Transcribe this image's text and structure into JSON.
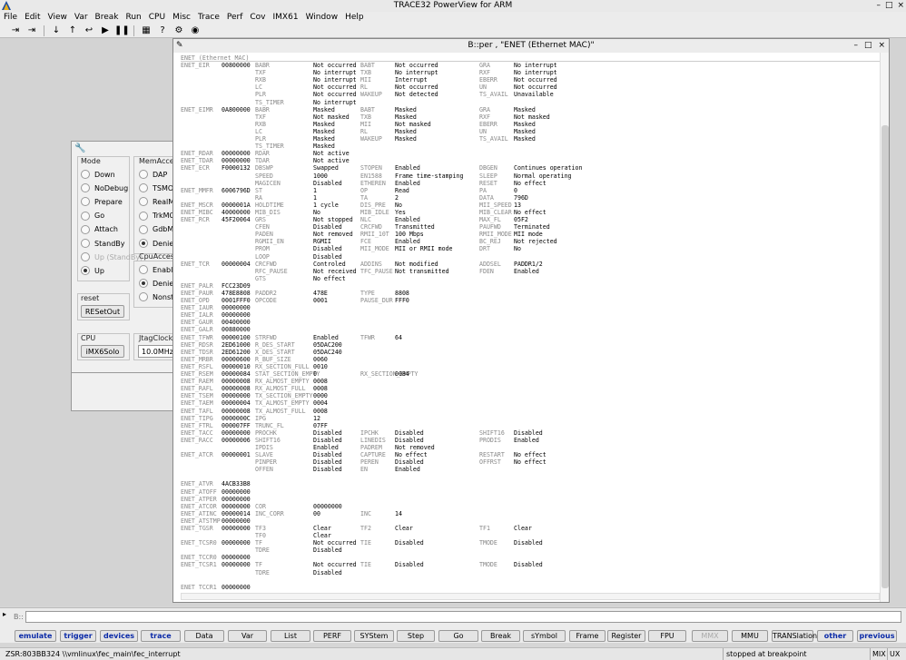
{
  "window": {
    "title": "TRACE32 PowerView for ARM"
  },
  "menu": [
    "File",
    "Edit",
    "View",
    "Var",
    "Break",
    "Run",
    "CPU",
    "Misc",
    "Trace",
    "Perf",
    "Cov",
    "IMX61",
    "Window",
    "Help"
  ],
  "toolbar": {
    "icons": [
      "step-into-icon",
      "step-over-icon",
      "step-down-icon",
      "step-up-icon",
      "return-icon",
      "go-icon",
      "break-icon",
      "config-icon",
      "help-icon",
      "about-icon",
      "globe-icon"
    ]
  },
  "system": {
    "mode_label": "Mode",
    "modes": [
      {
        "label": "Down"
      },
      {
        "label": "NoDebug"
      },
      {
        "label": "Prepare"
      },
      {
        "label": "Go"
      },
      {
        "label": "Attach"
      },
      {
        "label": "StandBy"
      },
      {
        "label": "Up (StandBy)",
        "disabled": true
      },
      {
        "label": "Up",
        "selected": true
      }
    ],
    "memaccess_label": "MemAcces",
    "memaccess": [
      {
        "label": "DAP"
      },
      {
        "label": "TSMON"
      },
      {
        "label": "RealMo"
      },
      {
        "label": "TrkMO"
      },
      {
        "label": "GdbMO"
      },
      {
        "label": "Deniec",
        "selected": true
      }
    ],
    "cpuaccess_label": "CpuAccess",
    "cpuaccess": [
      {
        "label": "Enable"
      },
      {
        "label": "Deniec",
        "selected": true
      },
      {
        "label": "Nonsto"
      }
    ],
    "reset_label": "reset",
    "reset_button": "RESetOut",
    "cpu_label": "CPU",
    "cpu_button": "iMX6Solo",
    "jtag_label": "JtagClock",
    "jtag_value": "10.0MHz"
  },
  "per": {
    "title": "B::per , \"ENET (Ethernet MAC)\"",
    "header": "ENET (Ethernet MAC)",
    "rows": [
      [
        "ENET_EIR",
        "00800000",
        "BABR",
        "Not occurred",
        "BABT",
        "Not occurred",
        "GRA",
        "No interrupt"
      ],
      [
        "",
        "",
        "TXF",
        "No interrupt",
        "TXB",
        "No interrupt",
        "RXF",
        "No interrupt"
      ],
      [
        "",
        "",
        "RXB",
        "No interrupt",
        "MII",
        "Interrupt",
        "EBERR",
        "Not occurred"
      ],
      [
        "",
        "",
        "LC",
        "Not occurred",
        "RL",
        "Not occurred",
        "UN",
        "Not occurred"
      ],
      [
        "",
        "",
        "PLR",
        "Not occurred",
        "WAKEUP",
        "Not detected",
        "TS_AVAIL",
        "Unavailable"
      ],
      [
        "",
        "",
        "TS_TIMER",
        "No interrupt",
        "",
        "",
        "",
        ""
      ],
      [
        "ENET_EIMR",
        "0A800000",
        "BABR",
        "Masked",
        "BABT",
        "Masked",
        "GRA",
        "Masked"
      ],
      [
        "",
        "",
        "TXF",
        "Not masked",
        "TXB",
        "Masked",
        "RXF",
        "Not masked"
      ],
      [
        "",
        "",
        "RXB",
        "Masked",
        "MII",
        "Not masked",
        "EBERR",
        "Masked"
      ],
      [
        "",
        "",
        "LC",
        "Masked",
        "RL",
        "Masked",
        "UN",
        "Masked"
      ],
      [
        "",
        "",
        "PLR",
        "Masked",
        "WAKEUP",
        "Masked",
        "TS_AVAIL",
        "Masked"
      ],
      [
        "",
        "",
        "TS_TIMER",
        "Masked",
        "",
        "",
        "",
        ""
      ],
      [
        "ENET_RDAR",
        "00000000",
        "RDAR",
        "Not active",
        "",
        "",
        "",
        ""
      ],
      [
        "ENET_TDAR",
        "00000000",
        "TDAR",
        "Not active",
        "",
        "",
        "",
        ""
      ],
      [
        "ENET_ECR",
        "F0000132",
        "DBSWP",
        "Swapped",
        "STOPEN",
        "Enabled",
        "DBGEN",
        "Continues operation"
      ],
      [
        "",
        "",
        "SPEED",
        "1000",
        "EN1588",
        "Frame time-stamping",
        "SLEEP",
        "Normal operating"
      ],
      [
        "",
        "",
        "MAGICEN",
        "Disabled",
        "ETHEREN",
        "Enabled",
        "RESET",
        "No effect"
      ],
      [
        "ENET_MMFR",
        "6006796D",
        "ST",
        "1",
        "OP",
        "Read",
        "PA",
        "0"
      ],
      [
        "",
        "",
        "RA",
        "1",
        "TA",
        "2",
        "DATA",
        "796D"
      ],
      [
        "ENET_MSCR",
        "0000001A",
        "HOLDTIME",
        "1 cycle",
        "DIS_PRE",
        "No",
        "MII_SPEED",
        "13"
      ],
      [
        "ENET_MIBC",
        "40000000",
        "MIB_DIS",
        "No",
        "MIB_IDLE",
        "Yes",
        "MIB_CLEAR",
        "No effect"
      ],
      [
        "ENET_RCR",
        "45F20064",
        "GRS",
        "Not stopped",
        "NLC",
        "Enabled",
        "MAX_FL",
        "05F2"
      ],
      [
        "",
        "",
        "CFEN",
        "Disabled",
        "CRCFWD",
        "Transmitted",
        "PAUFWD",
        "Terminated"
      ],
      [
        "",
        "",
        "PADEN",
        "Not removed",
        "RMII_10T",
        "100 Mbps",
        "RMII_MODE",
        "MII mode"
      ],
      [
        "",
        "",
        "RGMII_EN",
        "RGMII",
        "FCE",
        "Enabled",
        "BC_REJ",
        "Not rejected"
      ],
      [
        "",
        "",
        "PROM",
        "Disabled",
        "MII_MODE",
        "MII or RMII mode",
        "DRT",
        "No"
      ],
      [
        "",
        "",
        "LOOP",
        "Disabled",
        "",
        "",
        "",
        ""
      ],
      [
        "ENET_TCR",
        "00000004",
        "CRCFWD",
        "Controled",
        "ADDINS",
        "Not modified",
        "ADDSEL",
        "PADDR1/2"
      ],
      [
        "",
        "",
        "RFC_PAUSE",
        "Not received",
        "TFC_PAUSE",
        "Not transmitted",
        "FDEN",
        "Enabled"
      ],
      [
        "",
        "",
        "GTS",
        "No effect",
        "",
        "",
        "",
        ""
      ],
      [
        "ENET_PALR",
        "FCC23D09",
        "",
        "",
        "",
        "",
        "",
        ""
      ],
      [
        "ENET_PAUR",
        "478E8808",
        "PADDR2",
        "478E",
        "TYPE",
        "8808",
        "",
        ""
      ],
      [
        "ENET_OPD",
        "0001FFF0",
        "OPCODE",
        "0001",
        "PAUSE_DUR",
        "FFF0",
        "",
        ""
      ],
      [
        "ENET_IAUR",
        "00000000",
        "",
        "",
        "",
        "",
        "",
        ""
      ],
      [
        "ENET_IALR",
        "00000000",
        "",
        "",
        "",
        "",
        "",
        ""
      ],
      [
        "ENET_GAUR",
        "00400000",
        "",
        "",
        "",
        "",
        "",
        ""
      ],
      [
        "ENET_GALR",
        "00880000",
        "",
        "",
        "",
        "",
        "",
        ""
      ],
      [
        "ENET_TFWR",
        "00000100",
        "STRFWD",
        "Enabled",
        "TFWR",
        "64",
        "",
        ""
      ],
      [
        "ENET_RDSR",
        "2ED61000",
        "R_DES_START",
        "05DAC200",
        "",
        "",
        "",
        ""
      ],
      [
        "ENET_TDSR",
        "2ED61200",
        "X_DES_START",
        "05DAC240",
        "",
        "",
        "",
        ""
      ],
      [
        "ENET_MRBR",
        "00000600",
        "R_BUF_SIZE",
        "0060",
        "",
        "",
        "",
        ""
      ],
      [
        "ENET_RSFL",
        "00000010",
        "RX_SECTION_FULL",
        "0010",
        "",
        "",
        "",
        ""
      ],
      [
        "ENET_RSEM",
        "00000084",
        "STAT_SECTION_EMPTY",
        "0",
        "RX_SECTION_EMPTY",
        "0084",
        "",
        ""
      ],
      [
        "ENET_RAEM",
        "00000008",
        "RX_ALMOST_EMPTY",
        "0008",
        "",
        "",
        "",
        ""
      ],
      [
        "ENET_RAFL",
        "00000008",
        "RX_ALMOST_FULL",
        "0008",
        "",
        "",
        "",
        ""
      ],
      [
        "ENET_TSEM",
        "00000000",
        "TX_SECTION_EMPTY",
        "0000",
        "",
        "",
        "",
        ""
      ],
      [
        "ENET_TAEM",
        "00000004",
        "TX_ALMOST_EMPTY",
        "0004",
        "",
        "",
        "",
        ""
      ],
      [
        "ENET_TAFL",
        "00000008",
        "TX_ALMOST_FULL",
        "0008",
        "",
        "",
        "",
        ""
      ],
      [
        "ENET_TIPG",
        "0000000C",
        "IPG",
        "12",
        "",
        "",
        "",
        ""
      ],
      [
        "ENET_FTRL",
        "000007FF",
        "TRUNC_FL",
        "07FF",
        "",
        "",
        "",
        ""
      ],
      [
        "ENET_TACC",
        "00000000",
        "PROCHK",
        "Disabled",
        "IPCHK",
        "Disabled",
        "SHIFT16",
        "Disabled"
      ],
      [
        "ENET_RACC",
        "00000006",
        "SHIFT16",
        "Disabled",
        "LINEDIS",
        "Disabled",
        "PRODIS",
        "Enabled"
      ],
      [
        "",
        "",
        "IPDIS",
        "Enabled",
        "PADREM",
        "Not removed",
        "",
        ""
      ],
      [
        "ENET_ATCR",
        "00000001",
        "SLAVE",
        "Disabled",
        "CAPTURE",
        "No effect",
        "RESTART",
        "No effect"
      ],
      [
        "",
        "",
        "PINPER",
        "Disabled",
        "PEREN",
        "Disabled",
        "OFFRST",
        "No effect"
      ],
      [
        "",
        "",
        "OFFEN",
        "Disabled",
        "EN",
        "Enabled",
        "",
        ""
      ],
      [
        "",
        "",
        "",
        "",
        "",
        "",
        "",
        ""
      ],
      [
        "ENET_ATVR",
        "4ACB33B8",
        "",
        "",
        "",
        "",
        "",
        ""
      ],
      [
        "ENET_ATOFF",
        "00000000",
        "",
        "",
        "",
        "",
        "",
        ""
      ],
      [
        "ENET_ATPER",
        "00000000",
        "",
        "",
        "",
        "",
        "",
        ""
      ],
      [
        "ENET_ATCOR",
        "00000000",
        "COR",
        "00000000",
        "",
        "",
        "",
        ""
      ],
      [
        "ENET_ATINC",
        "00000014",
        "INC_CORR",
        "00",
        "INC",
        "14",
        "",
        ""
      ],
      [
        "ENET_ATSTMP",
        "00000000",
        "",
        "",
        "",
        "",
        "",
        ""
      ],
      [
        "ENET_TGSR",
        "00000000",
        "TF3",
        "Clear",
        "TF2",
        "Clear",
        "TF1",
        "Clear"
      ],
      [
        "",
        "",
        "TF0",
        "Clear",
        "",
        "",
        "",
        ""
      ],
      [
        "ENET_TCSR0",
        "00000000",
        "TF",
        "Not occurred",
        "TIE",
        "Disabled",
        "TMODE",
        "Disabled"
      ],
      [
        "",
        "",
        "TDRE",
        "Disabled",
        "",
        "",
        "",
        ""
      ],
      [
        "ENET_TCCR0",
        "00000000",
        "",
        "",
        "",
        "",
        "",
        ""
      ],
      [
        "ENET_TCSR1",
        "00000000",
        "TF",
        "Not occurred",
        "TIE",
        "Disabled",
        "TMODE",
        "Disabled"
      ],
      [
        "",
        "",
        "TDRE",
        "Disabled",
        "",
        "",
        "",
        ""
      ],
      [
        "",
        "",
        "",
        "",
        "",
        "",
        "",
        ""
      ],
      [
        "ENET_TCCR1",
        "00000000",
        "",
        "",
        "",
        "",
        "",
        ""
      ],
      [
        "ENET_TCSR2",
        "00000000",
        "TF",
        "Not occurred",
        "TIE",
        "Disabled",
        "TMODE",
        "Disabled"
      ],
      [
        "",
        "",
        "TDRE",
        "Disabled",
        "",
        "",
        "",
        ""
      ]
    ]
  },
  "cmdline": {
    "label": "B::"
  },
  "softkeys": [
    {
      "label": "emulate",
      "style": "blue"
    },
    {
      "label": "trigger",
      "style": "blue"
    },
    {
      "label": "devices",
      "style": "blue"
    },
    {
      "label": "trace",
      "style": "blue"
    },
    {
      "label": "Data"
    },
    {
      "label": "Var"
    },
    {
      "label": "List"
    },
    {
      "label": "PERF"
    },
    {
      "label": "SYStem"
    },
    {
      "label": "Step"
    },
    {
      "label": "Go"
    },
    {
      "label": "Break"
    },
    {
      "label": "sYmbol"
    },
    {
      "label": "Frame"
    },
    {
      "label": "Register"
    },
    {
      "label": "FPU"
    },
    {
      "label": "MMX",
      "style": "dis"
    },
    {
      "label": "MMU"
    },
    {
      "label": "TRANSlation"
    },
    {
      "label": "other",
      "style": "blue"
    },
    {
      "label": "previous",
      "style": "blue"
    }
  ],
  "status": {
    "path": "ZSR:803BB324  \\\\vmlinux\\fec_main\\fec_interrupt",
    "state": "stopped at breakpoint",
    "mix": "MIX",
    "ux": "UX"
  }
}
